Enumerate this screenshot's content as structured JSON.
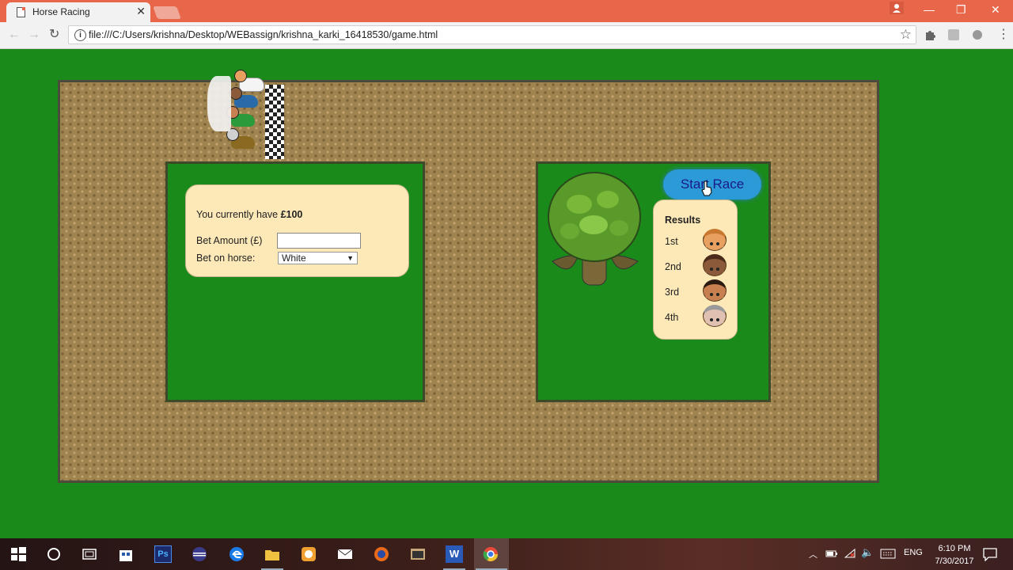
{
  "browser": {
    "tab_title": "Horse Racing",
    "tab_close": "✕",
    "url": "file:///C:/Users/krishna/Desktop/WEBassign/krishna_karki_16418530/game.html",
    "window_controls": {
      "minimize": "—",
      "restore": "❐",
      "close": "✕"
    }
  },
  "bet_panel": {
    "money_prefix": "You currently have ",
    "money_amount": "£100",
    "bet_amount_label": "Bet Amount (£)",
    "bet_amount_value": "",
    "bet_horse_label": "Bet on horse:",
    "bet_horse_selected": "White",
    "select_caret": "▼"
  },
  "start_button": {
    "label": "Start Race"
  },
  "results": {
    "title": "Results",
    "places": [
      {
        "place": "1st",
        "face_color": "#e8a060",
        "hair_color": "#c87830"
      },
      {
        "place": "2nd",
        "face_color": "#8a5a3a",
        "hair_color": "#4a2a1a"
      },
      {
        "place": "3rd",
        "face_color": "#c88050",
        "hair_color": "#2a1a10"
      },
      {
        "place": "4th",
        "face_color": "#e0c0b0",
        "hair_color": "#9a9a9a"
      }
    ]
  },
  "racers": [
    {
      "name": "white",
      "color": "#f4f4f4",
      "head": "#e8a060"
    },
    {
      "name": "blue",
      "color": "#2a6aa8",
      "head": "#8a5a3a"
    },
    {
      "name": "green",
      "color": "#2a9a3a",
      "head": "#c88050"
    },
    {
      "name": "brown",
      "color": "#8a6a20",
      "head": "#d0d0d0"
    }
  ],
  "taskbar": {
    "language": "ENG",
    "time": "6:10 PM",
    "date": "7/30/2017"
  },
  "colors": {
    "field": "#1a8a1a",
    "track": "#a08450",
    "panel": "#fde9b8",
    "button": "#2d9ad8"
  }
}
